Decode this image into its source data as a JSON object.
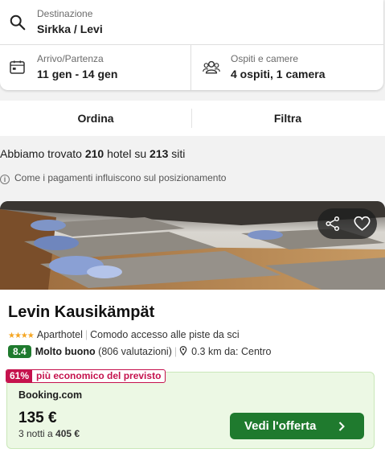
{
  "search": {
    "destination_label": "Destinazione",
    "destination_value": "Sirkka / Levi",
    "dates_label": "Arrivo/Partenza",
    "dates_value": "11 gen - 14 gen",
    "guests_label": "Ospiti e camere",
    "guests_value": "4 ospiti, 1 camera"
  },
  "toolbar": {
    "sort_label": "Ordina",
    "filter_label": "Filtra"
  },
  "results": {
    "prefix": "Abbiamo trovato",
    "hotel_count": "210",
    "middle": "hotel su",
    "site_count": "213",
    "suffix": "siti",
    "payment_info": "Come i pagamenti influiscono sul posizionamento"
  },
  "hotel": {
    "name": "Levin Kausikämpät",
    "stars": "★★★★",
    "type": "Aparthotel",
    "feature": "Comodo accesso alle piste da sci",
    "rating": "8.4",
    "rating_label": "Molto buono",
    "reviews": "(806 valutazioni)",
    "distance": "0.3 km da: Centro",
    "deal_pct": "61%",
    "deal_text": "più economico del previsto",
    "provider": "Booking.com",
    "price": "135 €",
    "nights_text": "3 notti a",
    "total": "405 €",
    "cta_label": "Vedi l'offerta"
  },
  "icons": {
    "search": "search-icon",
    "calendar": "calendar-icon",
    "guests": "guests-icon",
    "info": "info-icon",
    "share": "share-icon",
    "favorite": "heart-icon",
    "location": "location-pin-icon",
    "chevron": "chevron-right-icon"
  },
  "colors": {
    "rating_green": "#1f7a2e",
    "deal_red": "#c5124d",
    "deal_bg": "#ecf8e4",
    "star": "#f5a623"
  }
}
